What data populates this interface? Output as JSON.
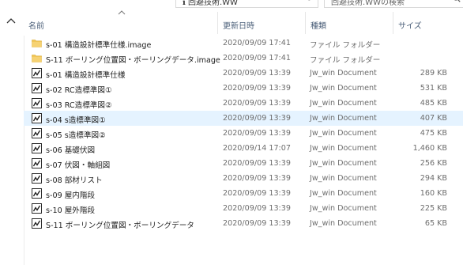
{
  "toolbar": {
    "address_text": "ℹ 回避技術.WW",
    "refresh_glyph": "↻",
    "search_placeholder": "回避技術.WWの検索"
  },
  "columns": {
    "name": "名前",
    "date": "更新日時",
    "type": "種類",
    "size": "サイズ"
  },
  "files": [
    {
      "icon": "folder-icon",
      "name": "s-01 構造設計標準仕様.image",
      "date": "2020/09/09 17:41",
      "type": "ファイル フォルダー",
      "size": ""
    },
    {
      "icon": "folder-icon",
      "name": "S-11 ボーリング位置図・ボーリングデータ.image",
      "date": "2020/09/09 17:41",
      "type": "ファイル フォルダー",
      "size": ""
    },
    {
      "icon": "jw-document-icon",
      "name": "s-01 構造設計標準仕様",
      "date": "2020/09/09 13:39",
      "type": "Jw_win Document",
      "size": "289 KB"
    },
    {
      "icon": "jw-document-icon",
      "name": "s-02 RC造標準図①",
      "date": "2020/09/09 13:39",
      "type": "Jw_win Document",
      "size": "531 KB"
    },
    {
      "icon": "jw-document-icon",
      "name": "s-03 RC造標準図②",
      "date": "2020/09/09 13:39",
      "type": "Jw_win Document",
      "size": "485 KB"
    },
    {
      "icon": "jw-document-icon",
      "name": "s-04 s造標準図①",
      "date": "2020/09/09 13:39",
      "type": "Jw_win Document",
      "size": "407 KB",
      "selected": true
    },
    {
      "icon": "jw-document-icon",
      "name": "s-05 s造標準図②",
      "date": "2020/09/09 13:39",
      "type": "Jw_win Document",
      "size": "475 KB"
    },
    {
      "icon": "jw-document-icon",
      "name": "s-06 基礎伏図",
      "date": "2020/09/14 17:07",
      "type": "Jw_win Document",
      "size": "1,460 KB"
    },
    {
      "icon": "jw-document-icon",
      "name": "s-07 伏図・軸組図",
      "date": "2020/09/09 13:39",
      "type": "Jw_win Document",
      "size": "256 KB"
    },
    {
      "icon": "jw-document-icon",
      "name": "s-08 部材リスト",
      "date": "2020/09/09 13:39",
      "type": "Jw_win Document",
      "size": "294 KB"
    },
    {
      "icon": "jw-document-icon",
      "name": "s-09 屋内階段",
      "date": "2020/09/09 13:39",
      "type": "Jw_win Document",
      "size": "160 KB"
    },
    {
      "icon": "jw-document-icon",
      "name": "s-10 屋外階段",
      "date": "2020/09/09 13:39",
      "type": "Jw_win Document",
      "size": "225 KB"
    },
    {
      "icon": "jw-document-icon",
      "name": "S-11 ボーリング位置図・ボーリングデータ",
      "date": "2020/09/09 13:39",
      "type": "Jw_win Document",
      "size": "65 KB"
    }
  ],
  "colors": {
    "selected_row": "#e5f3ff",
    "folder": "#f0c452",
    "header_text": "#4c607a"
  }
}
